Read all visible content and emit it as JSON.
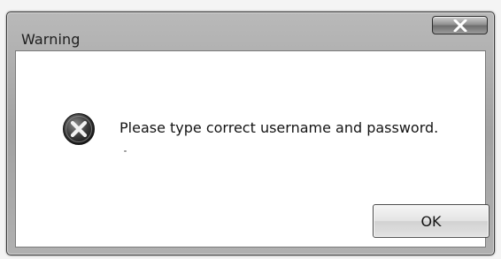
{
  "dialog": {
    "title": "Warning",
    "message": "Please type correct username and password.",
    "ok_label": "OK",
    "close_icon": "close-icon",
    "message_icon": "error-icon"
  },
  "colors": {
    "frame": "#a8a8a8",
    "content_background": "#ffffff",
    "icon_circle": "#3b3b3b"
  }
}
